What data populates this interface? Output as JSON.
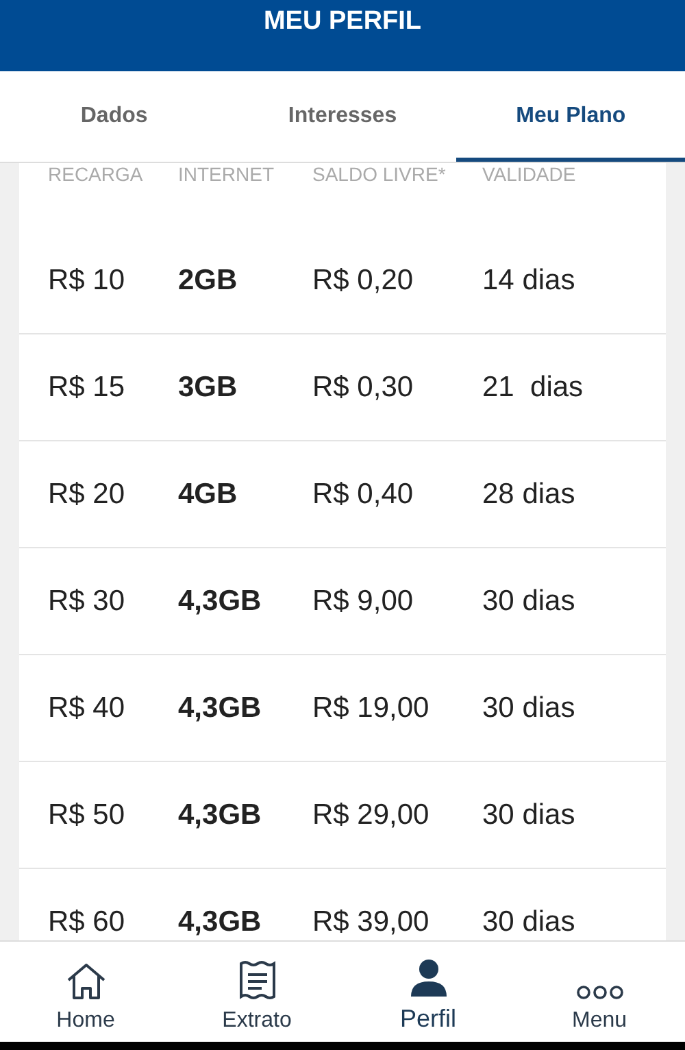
{
  "header": {
    "title": "MEU PERFIL"
  },
  "tabs": [
    {
      "label": "Dados",
      "selected": false
    },
    {
      "label": "Interesses",
      "selected": false
    },
    {
      "label": "Meu Plano",
      "selected": true
    }
  ],
  "table": {
    "columns": [
      "RECARGA",
      "INTERNET",
      "SALDO LIVRE*",
      "VALIDADE"
    ],
    "rows": [
      [
        "R$ 10",
        "2GB",
        "R$ 0,20",
        "14 dias"
      ],
      [
        "R$ 15",
        "3GB",
        "R$ 0,30",
        "21  dias"
      ],
      [
        "R$ 20",
        "4GB",
        "R$ 0,40",
        "28 dias"
      ],
      [
        "R$ 30",
        "4,3GB",
        "R$ 9,00",
        "30 dias"
      ],
      [
        "R$ 40",
        "4,3GB",
        "R$ 19,00",
        "30 dias"
      ],
      [
        "R$ 50",
        "4,3GB",
        "R$ 29,00",
        "30 dias"
      ],
      [
        "R$ 60",
        "4,3GB",
        "R$ 39,00",
        "30 dias"
      ]
    ]
  },
  "bottom_nav": [
    {
      "kind": "home",
      "label": "Home",
      "selected": false
    },
    {
      "kind": "receipt",
      "label": "Extrato",
      "selected": false
    },
    {
      "kind": "person",
      "label": "Perfil",
      "selected": true
    },
    {
      "kind": "more",
      "label": "Menu",
      "selected": false
    }
  ]
}
